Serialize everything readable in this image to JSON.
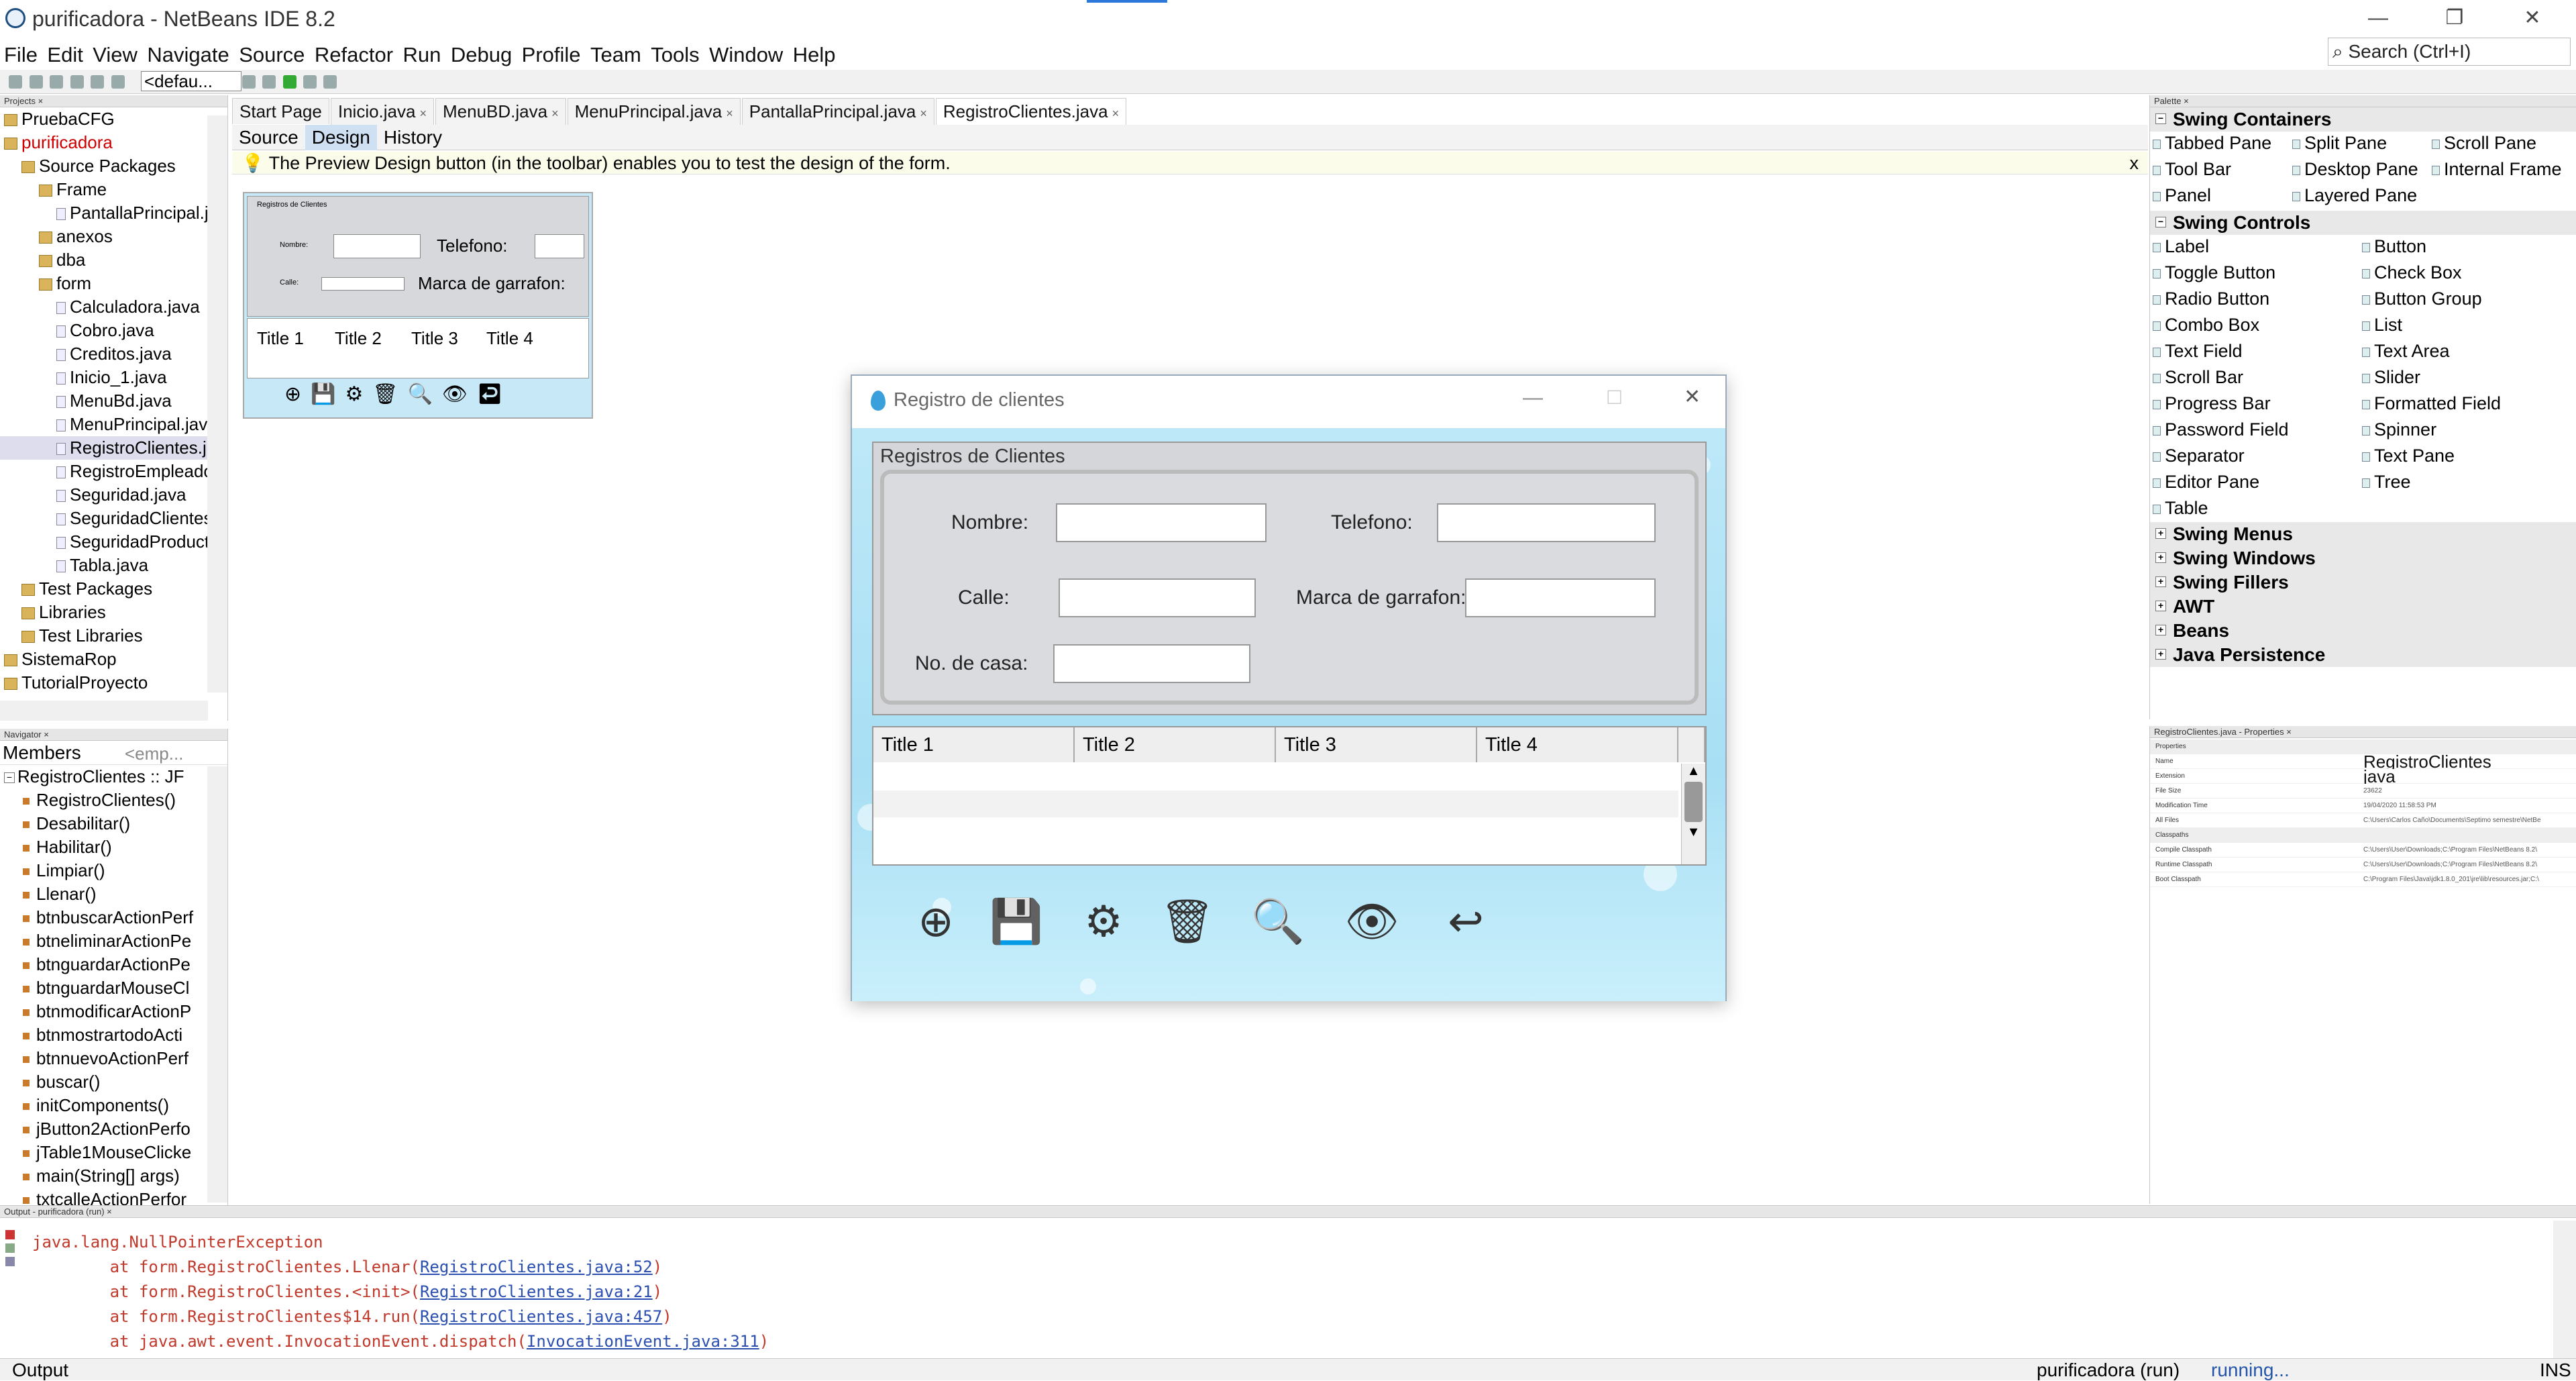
{
  "window": {
    "title": "purificadora - NetBeans IDE 8.2",
    "minimize": "—",
    "restore": "❐",
    "close": "✕"
  },
  "menu": [
    "File",
    "Edit",
    "View",
    "Navigate",
    "Source",
    "Refactor",
    "Run",
    "Debug",
    "Profile",
    "Team",
    "Tools",
    "Window",
    "Help"
  ],
  "search": {
    "placeholder": "Search (Ctrl+I)"
  },
  "toolbar": {
    "config": "<defau..."
  },
  "projects": {
    "header": "Projects ×",
    "items": [
      {
        "label": "PruebaCFG",
        "indent": 0,
        "type": "project"
      },
      {
        "label": "purificadora",
        "indent": 0,
        "type": "project",
        "color": "#cc0000"
      },
      {
        "label": "Source Packages",
        "indent": 1,
        "type": "pkg"
      },
      {
        "label": "Frame",
        "indent": 2,
        "type": "pkg"
      },
      {
        "label": "PantallaPrincipal.j",
        "indent": 3,
        "type": "file"
      },
      {
        "label": "anexos",
        "indent": 2,
        "type": "pkg"
      },
      {
        "label": "dba",
        "indent": 2,
        "type": "pkg"
      },
      {
        "label": "form",
        "indent": 2,
        "type": "pkg"
      },
      {
        "label": "Calculadora.java",
        "indent": 3,
        "type": "file"
      },
      {
        "label": "Cobro.java",
        "indent": 3,
        "type": "file"
      },
      {
        "label": "Creditos.java",
        "indent": 3,
        "type": "file"
      },
      {
        "label": "Inicio_1.java",
        "indent": 3,
        "type": "file"
      },
      {
        "label": "MenuBd.java",
        "indent": 3,
        "type": "file"
      },
      {
        "label": "MenuPrincipal.jav",
        "indent": 3,
        "type": "file"
      },
      {
        "label": "RegistroClientes.j",
        "indent": 3,
        "type": "file",
        "selected": true
      },
      {
        "label": "RegistroEmpleado",
        "indent": 3,
        "type": "file"
      },
      {
        "label": "Seguridad.java",
        "indent": 3,
        "type": "file"
      },
      {
        "label": "SeguridadClientes",
        "indent": 3,
        "type": "file"
      },
      {
        "label": "SeguridadProduct",
        "indent": 3,
        "type": "file"
      },
      {
        "label": "Tabla.java",
        "indent": 3,
        "type": "file"
      },
      {
        "label": "Test Packages",
        "indent": 1,
        "type": "pkg"
      },
      {
        "label": "Libraries",
        "indent": 1,
        "type": "pkg"
      },
      {
        "label": "Test Libraries",
        "indent": 1,
        "type": "pkg"
      },
      {
        "label": "SistemaRop",
        "indent": 0,
        "type": "project"
      },
      {
        "label": "TutorialProyecto",
        "indent": 0,
        "type": "project"
      }
    ]
  },
  "navigator": {
    "header": "Navigator ×",
    "filter": "Members",
    "filter2": "<emp...",
    "root": "RegistroClientes :: JF",
    "members": [
      "RegistroClientes()",
      "Desabilitar()",
      "Habilitar()",
      "Limpiar()",
      "Llenar()",
      "btnbuscarActionPerf",
      "btneliminarActionPe",
      "btnguardarActionPe",
      "btnguardarMouseCl",
      "btnmodificarActionP",
      "btnmostrartodoActi",
      "btnnuevoActionPerf",
      "buscar()",
      "initComponents()",
      "jButton2ActionPerfo",
      "jTable1MouseClicke",
      "main(String[] args)",
      "txtcalleActionPerfor"
    ]
  },
  "editor": {
    "tabs": [
      "Start Page",
      "Inicio.java",
      "MenuBD.java",
      "MenuPrincipal.java",
      "PantallaPrincipal.java",
      "RegistroClientes.java"
    ],
    "active_tab": 5,
    "subtabs": [
      "Source",
      "Design",
      "History"
    ],
    "active_subtab": 1,
    "hint": "The Preview Design button (in the toolbar) enables you to test the design of the form.",
    "hint_close": "x"
  },
  "preview": {
    "group": "Registros de Clientes",
    "nombre": "Nombre:",
    "telefono": "Telefono:",
    "calle": "Calle:",
    "marca": "Marca de garrafon:",
    "cols": [
      "Title 1",
      "Title 2",
      "Title 3",
      "Title 4"
    ]
  },
  "form": {
    "title": "Registro de clientes",
    "group": "Registros de Clientes",
    "labels": {
      "nombre": "Nombre:",
      "telefono": "Telefono:",
      "calle": "Calle:",
      "marca": "Marca de garrafon:",
      "numero": "No. de casa:"
    },
    "columns": [
      "Title 1",
      "Title 2",
      "Title 3",
      "Title 4"
    ],
    "buttons": [
      {
        "name": "new-button",
        "glyph": "⊕"
      },
      {
        "name": "save-button",
        "glyph": "💾"
      },
      {
        "name": "settings-button",
        "glyph": "⚙"
      },
      {
        "name": "delete-button",
        "glyph": "🗑"
      },
      {
        "name": "search-button",
        "glyph": "🔍"
      },
      {
        "name": "view-button",
        "glyph": "👁"
      },
      {
        "name": "back-button",
        "glyph": "↩"
      }
    ]
  },
  "palette": {
    "header": "Palette ×",
    "containers_title": "Swing Containers",
    "containers": [
      "Tabbed Pane",
      "Split Pane",
      "Scroll Pane",
      "Tool Bar",
      "Desktop Pane",
      "Internal Frame",
      "Panel",
      "Layered Pane"
    ],
    "controls_title": "Swing Controls",
    "controls": [
      "Label",
      "Button",
      "Toggle Button",
      "Check Box",
      "Radio Button",
      "Button Group",
      "Combo Box",
      "List",
      "Text Field",
      "Text Area",
      "Scroll Bar",
      "Slider",
      "Progress Bar",
      "Formatted Field",
      "Password Field",
      "Spinner",
      "Separator",
      "Text Pane",
      "Editor Pane",
      "Tree",
      "Table"
    ],
    "collapsed": [
      "Swing Menus",
      "Swing Windows",
      "Swing Fillers",
      "AWT",
      "Beans",
      "Java Persistence"
    ]
  },
  "properties": {
    "header": "RegistroClientes.java - Properties ×",
    "section1": "Properties",
    "rows": [
      {
        "n": "Name",
        "v": "RegistroClientes"
      },
      {
        "n": "Extension",
        "v": "java"
      },
      {
        "n": "File Size",
        "v": "23622"
      },
      {
        "n": "Modification Time",
        "v": "19/04/2020 11:58:53 PM"
      },
      {
        "n": "All Files",
        "v": "C:\\Users\\Carlos Caño\\Documents\\Septimo semestre\\NetBe"
      }
    ],
    "section2": "Classpaths",
    "rows2": [
      {
        "n": "Compile Classpath",
        "v": "C:\\Users\\User\\Downloads;C:\\Program Files\\NetBeans 8.2\\"
      },
      {
        "n": "Runtime Classpath",
        "v": "C:\\Users\\User\\Downloads;C:\\Program Files\\NetBeans 8.2\\"
      },
      {
        "n": "Boot Classpath",
        "v": "C:\\Program Files\\Java\\jdk1.8.0_201\\jre\\lib\\resources.jar;C:\\"
      }
    ]
  },
  "output": {
    "header": "Output - purificadora (run) ×",
    "lines": [
      {
        "pre": "java.lang.NullPointerException",
        "link": "",
        "post": ""
      },
      {
        "pre": "\tat form.RegistroClientes.Llenar(",
        "link": "RegistroClientes.java:52",
        "post": ")"
      },
      {
        "pre": "\tat form.RegistroClientes.<init>(",
        "link": "RegistroClientes.java:21",
        "post": ")"
      },
      {
        "pre": "\tat form.RegistroClientes$14.run(",
        "link": "RegistroClientes.java:457",
        "post": ")"
      },
      {
        "pre": "\tat java.awt.event.InvocationEvent.dispatch(",
        "link": "InvocationEvent.java:311",
        "post": ")"
      }
    ]
  },
  "status": {
    "tab": "Output",
    "project": "purificadora (run)",
    "running": "running...",
    "mode": "INS"
  }
}
